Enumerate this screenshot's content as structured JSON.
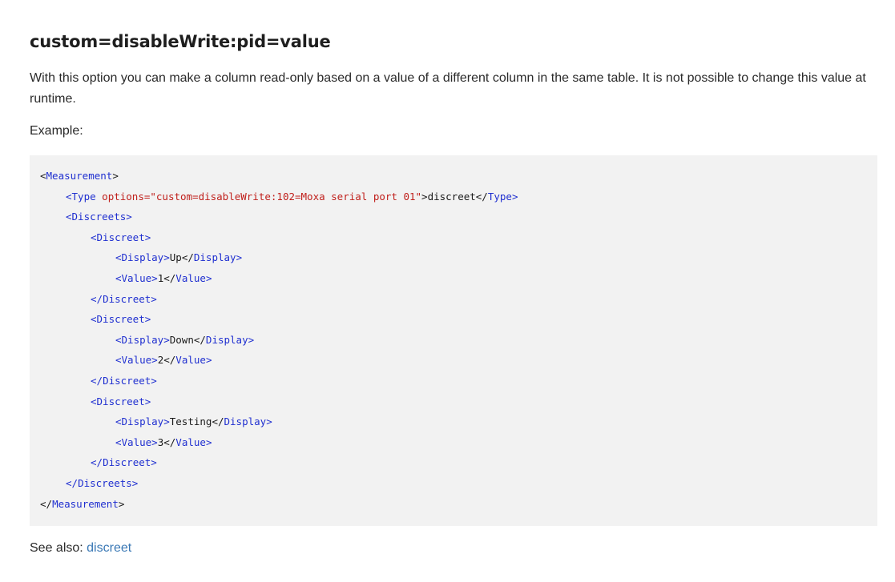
{
  "heading": "custom=disableWrite:pid=value",
  "description": "With this option you can make a column read-only based on a value of a different column in the same table. It is not possible to change this value at runtime.",
  "example_label": "Example:",
  "code": {
    "l1_open": "<",
    "l1_tag": "Measurement",
    "l1_close": ">",
    "l2_open": "<",
    "l2_tag": "Type",
    "l2_attr": " options=",
    "l2_val": "\"custom=disableWrite:102=Moxa serial port 01\"",
    "l2_gt": ">",
    "l2_text": "discreet",
    "l2_end_open": "</",
    "l2_end_tag": "Type",
    "l2_end_close": ">",
    "discreets_tag": "Discreets",
    "discreet_tag": "Discreet",
    "display_tag": "Display",
    "value_tag": "Value",
    "item1_display": "Up",
    "item1_value": "1",
    "item2_display": "Down",
    "item2_value": "2",
    "item3_display": "Testing",
    "item3_value": "3",
    "lt": "<",
    "lt_slash": "</",
    "gt": ">"
  },
  "see_also": {
    "label": "See also: ",
    "link_text": "discreet"
  }
}
